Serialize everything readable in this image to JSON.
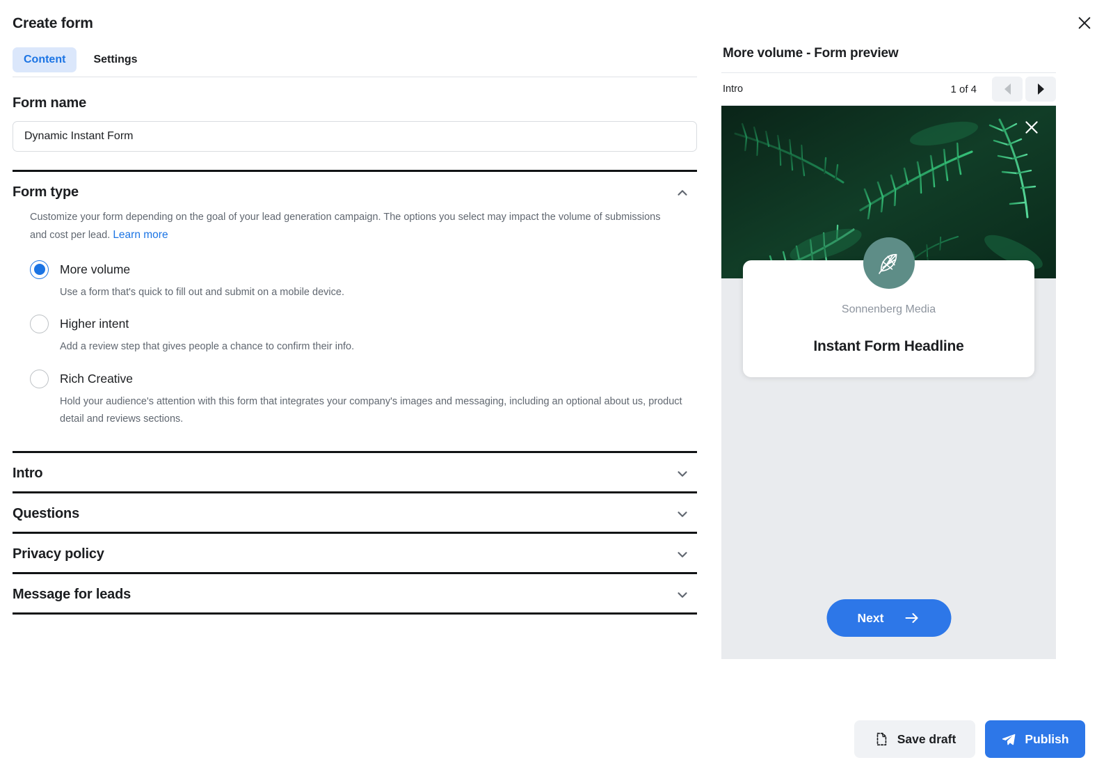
{
  "modal": {
    "title": "Create form",
    "close_icon": "close-icon"
  },
  "tabs": [
    {
      "label": "Content",
      "active": true
    },
    {
      "label": "Settings",
      "active": false
    }
  ],
  "form_name": {
    "label": "Form name",
    "value": "Dynamic Instant Form",
    "placeholder": "Form name"
  },
  "form_type": {
    "title": "Form type",
    "expanded": true,
    "chevron_icon": "chevron-up-icon",
    "description": "Customize your form depending on the goal of your lead generation campaign. The options you select may impact the volume of submissions and cost per lead.",
    "learn_more": "Learn more",
    "options": [
      {
        "label": "More volume",
        "description": "Use a form that's quick to fill out and submit on a mobile device.",
        "selected": true
      },
      {
        "label": "Higher intent",
        "description": "Add a review step that gives people a chance to confirm their info.",
        "selected": false
      },
      {
        "label": "Rich Creative",
        "description": "Hold your audience's attention with this form that integrates your company's images and messaging, including an optional about us, product detail and reviews sections.",
        "selected": false
      }
    ]
  },
  "sections": [
    {
      "title": "Intro",
      "chevron_icon": "chevron-down-icon"
    },
    {
      "title": "Questions",
      "chevron_icon": "chevron-down-icon"
    },
    {
      "title": "Privacy policy",
      "chevron_icon": "chevron-down-icon"
    },
    {
      "title": "Message for leads",
      "chevron_icon": "chevron-down-icon"
    }
  ],
  "preview": {
    "title": "More volume - Form preview",
    "step_label": "Intro",
    "step_count": "1 of 4",
    "prev_icon": "triangle-left-icon",
    "next_icon": "triangle-right-icon",
    "hero_close_icon": "close-icon",
    "logo_icon": "leaf-logo-icon",
    "brand": "Sonnenberg Media",
    "headline": "Instant Form Headline",
    "next_button": "Next",
    "next_button_icon": "arrow-right-icon"
  },
  "footer": {
    "save_draft": "Save draft",
    "save_draft_icon": "document-icon",
    "publish": "Publish",
    "publish_icon": "paper-plane-icon"
  },
  "colors": {
    "accent_blue": "#1b74e4",
    "button_blue": "#2d77e8",
    "tab_pill": "#dbe7fb",
    "preview_bg": "#e9ebee",
    "logo_teal": "#5e8d87",
    "muted_text": "#606770"
  }
}
